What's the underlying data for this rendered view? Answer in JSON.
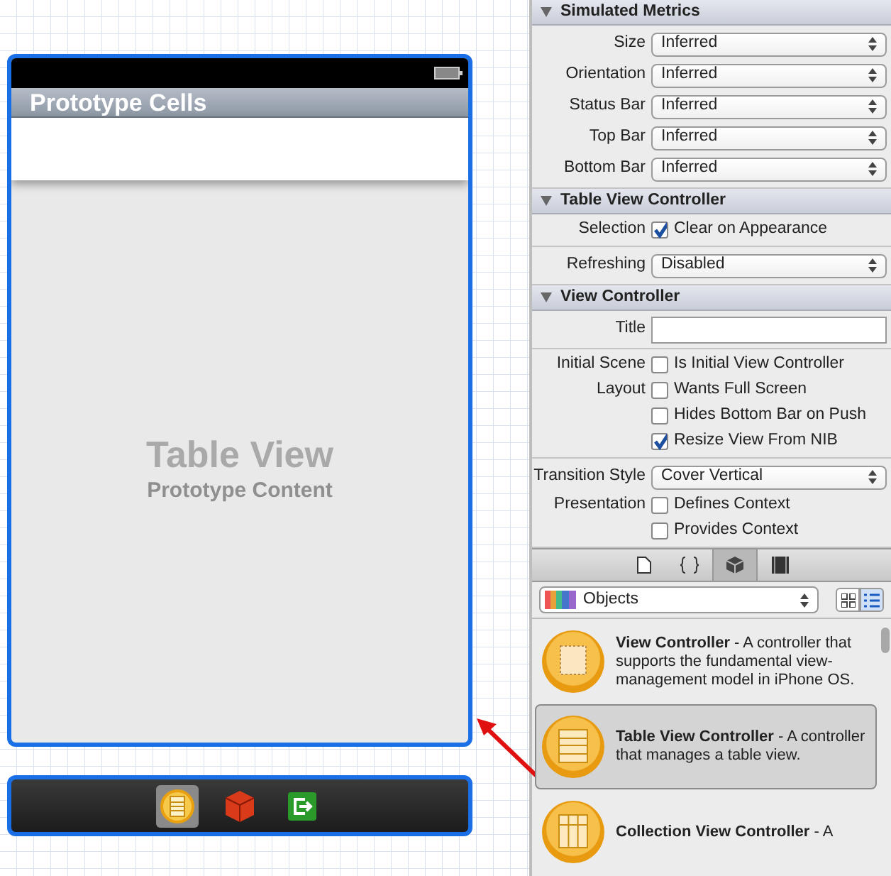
{
  "scene": {
    "nav_title": "Prototype Cells",
    "placeholder_title": "Table View",
    "placeholder_subtitle": "Prototype Content"
  },
  "dock": [
    {
      "kind": "table",
      "selected": true
    },
    {
      "kind": "cube",
      "selected": false
    },
    {
      "kind": "exit",
      "selected": false
    }
  ],
  "inspector": {
    "sections": [
      {
        "title": "Simulated Metrics",
        "expanded": true,
        "groups": [
          [
            {
              "kind": "popup",
              "label": "Size",
              "value": "Inferred"
            },
            {
              "kind": "popup",
              "label": "Orientation",
              "value": "Inferred"
            },
            {
              "kind": "popup",
              "label": "Status Bar",
              "value": "Inferred"
            },
            {
              "kind": "popup",
              "label": "Top Bar",
              "value": "Inferred"
            },
            {
              "kind": "popup",
              "label": "Bottom Bar",
              "value": "Inferred"
            }
          ]
        ]
      },
      {
        "title": "Table View Controller",
        "expanded": true,
        "groups": [
          [
            {
              "kind": "checkbox",
              "label": "Selection",
              "text": "Clear on Appearance",
              "checked": true
            }
          ],
          [
            {
              "kind": "popup",
              "label": "Refreshing",
              "value": "Disabled"
            }
          ]
        ]
      },
      {
        "title": "View Controller",
        "expanded": true,
        "groups": [
          [
            {
              "kind": "field",
              "label": "Title"
            }
          ],
          [
            {
              "kind": "checkbox",
              "label": "Initial Scene",
              "text": "Is Initial View Controller",
              "checked": false
            },
            {
              "kind": "checkbox",
              "label": "Layout",
              "text": "Wants Full Screen",
              "checked": false
            },
            {
              "kind": "checkbox",
              "text": "Hides Bottom Bar on Push",
              "checked": false
            },
            {
              "kind": "checkbox",
              "text": "Resize View From NIB",
              "checked": true
            }
          ],
          [
            {
              "kind": "popup",
              "label": "Transition Style",
              "value": "Cover Vertical"
            },
            {
              "kind": "checkbox",
              "label": "Presentation",
              "text": "Defines Context",
              "checked": false
            },
            {
              "kind": "checkbox",
              "text": "Provides Context",
              "checked": false
            }
          ]
        ]
      }
    ]
  },
  "library": {
    "tabs": [
      {
        "kind": "file",
        "selected": false
      },
      {
        "kind": "braces",
        "selected": false
      },
      {
        "kind": "cube",
        "selected": true
      },
      {
        "kind": "media",
        "selected": false
      }
    ],
    "filter": "Objects",
    "views": [
      {
        "kind": "grid",
        "selected": false
      },
      {
        "kind": "list",
        "selected": true
      }
    ],
    "items": [
      {
        "kind": "view",
        "text": "**View Controller** - A controller that supports the fundamental view-management model in iPhone OS.",
        "selected": false
      },
      {
        "kind": "table",
        "text": "**Table View Controller** - A controller that manages a table view.",
        "selected": true
      },
      {
        "kind": "collection",
        "text": "**Collection View Controller** - A",
        "selected": false
      }
    ]
  }
}
